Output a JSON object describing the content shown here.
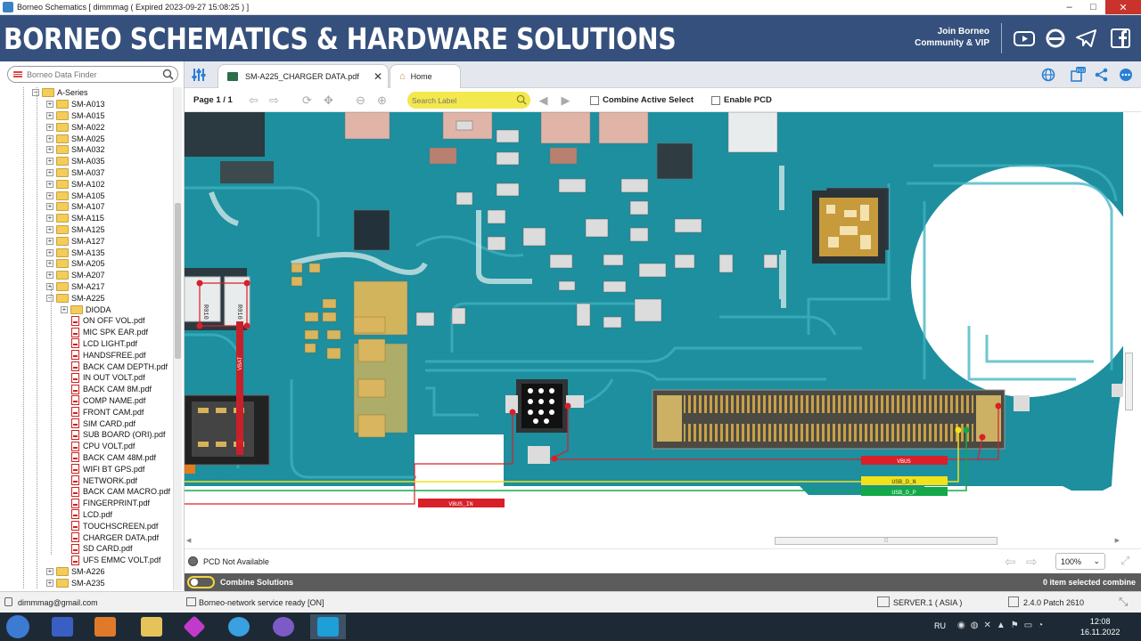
{
  "window": {
    "title": "Borneo Schematics [ dimmmag ( Expired 2023-09-27 15:08:25 ) ]"
  },
  "banner": {
    "brand": "BORNEO SCHEMATICS & HARDWARE SOLUTIONS",
    "join_line1": "Join Borneo",
    "join_line2": "Community & VIP"
  },
  "sidebar": {
    "search_placeholder": "Borneo Data Finder",
    "root": "A-Series",
    "models_top": [
      "SM-A013",
      "SM-A015",
      "SM-A022",
      "SM-A025",
      "SM-A032",
      "SM-A035",
      "SM-A037",
      "SM-A102",
      "SM-A105",
      "SM-A107",
      "SM-A115",
      "SM-A125",
      "SM-A127",
      "SM-A135",
      "SM-A205",
      "SM-A207",
      "SM-A217"
    ],
    "open_model": "SM-A225",
    "subfolder": "DIODA",
    "files": [
      "ON OFF VOL.pdf",
      "MIC SPK EAR.pdf",
      "LCD LIGHT.pdf",
      "HANDSFREE.pdf",
      "BACK CAM DEPTH.pdf",
      "IN OUT VOLT.pdf",
      "BACK CAM 8M.pdf",
      "COMP NAME.pdf",
      "FRONT CAM.pdf",
      "SIM CARD.pdf",
      "SUB BOARD (ORI).pdf",
      "CPU VOLT.pdf",
      "BACK CAM 48M.pdf",
      "WIFI BT GPS.pdf",
      "NETWORK.pdf",
      "BACK CAM MACRO.pdf",
      "FINGERPRINT.pdf",
      "LCD.pdf",
      "TOUCHSCREEN.pdf",
      "CHARGER DATA.pdf",
      "SD CARD.pdf",
      "UFS EMMC VOLT.pdf"
    ],
    "models_bottom": [
      "SM-A226",
      "SM-A235"
    ]
  },
  "tabs": {
    "doc_tab": "SM-A225_CHARGER DATA.pdf",
    "home_tab": "Home"
  },
  "toolbar": {
    "page": "Page 1 / 1",
    "label_placeholder": "Search Label",
    "combine_active": "Combine Active Select",
    "enable_pcd": "Enable PCD"
  },
  "board": {
    "net_vbus": "VBUS",
    "net_vbus_in": "VBUS_IN",
    "net_usb_dn": "USB_D_N",
    "net_usb_dp": "USB_D_P",
    "net_vbat": "VBAT",
    "r1": "R010",
    "r2": "R010",
    "colors": {
      "board": "#1c8f9e",
      "trace_red": "#d8202a",
      "trace_yellow": "#f2e21a",
      "trace_green": "#13a84a"
    }
  },
  "status": {
    "pcd": "PCD Not Available",
    "zoom": "100%",
    "combine": "Combine Solutions",
    "selected": "0 item selected combine",
    "user": "dimmmag@gmail.com",
    "network": "Borneo-network service ready [ON]",
    "server": "SERVER.1 ( ASIA )",
    "version": "2.4.0 Patch 2610"
  },
  "taskbar": {
    "lang": "RU",
    "time": "12:08",
    "date": "16.11.2022"
  }
}
